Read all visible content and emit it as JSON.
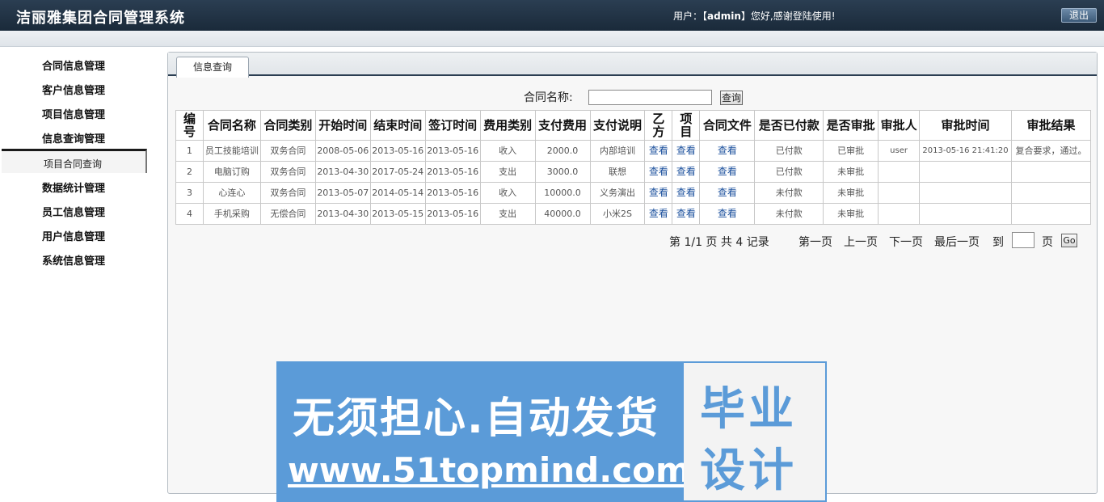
{
  "header": {
    "title": "洁丽雅集团合同管理系统",
    "user_prefix": "用户：【",
    "username": "admin",
    "user_suffix": "】您好,感谢登陆使用!",
    "logout_label": "退出"
  },
  "sidebar": {
    "items": [
      {
        "label": "合同信息管理"
      },
      {
        "label": "客户信息管理"
      },
      {
        "label": "项目信息管理"
      },
      {
        "label": "信息查询管理"
      },
      {
        "label": "数据统计管理"
      },
      {
        "label": "员工信息管理"
      },
      {
        "label": "用户信息管理"
      },
      {
        "label": "系统信息管理"
      }
    ],
    "active_sub": "项目合同查询"
  },
  "main": {
    "tab_label": "信息查询",
    "search": {
      "label": "合同名称:",
      "value": "",
      "button_label": "查询"
    },
    "table": {
      "headers": [
        "编号",
        "合同名称",
        "合同类别",
        "开始时间",
        "结束时间",
        "签订时间",
        "费用类别",
        "支付费用",
        "支付说明",
        "乙方",
        "项目",
        "合同文件",
        "是否已付款",
        "是否审批",
        "审批人",
        "审批时间",
        "审批结果"
      ],
      "rows": [
        [
          "1",
          "员工技能培训",
          "双务合同",
          "2008-05-06",
          "2013-05-16",
          "2013-05-16",
          "收入",
          "2000.0",
          "内部培训",
          "查看",
          "查看",
          "查看",
          "已付款",
          "已审批",
          "user",
          "2013-05-16 21:41:20",
          "复合要求，通过。"
        ],
        [
          "2",
          "电脑订购",
          "双务合同",
          "2013-04-30",
          "2017-05-24",
          "2013-05-16",
          "支出",
          "3000.0",
          "联想",
          "查看",
          "查看",
          "查看",
          "已付款",
          "未审批",
          "",
          "",
          ""
        ],
        [
          "3",
          "心连心",
          "双务合同",
          "2013-05-07",
          "2014-05-14",
          "2013-05-16",
          "收入",
          "10000.0",
          "义务演出",
          "查看",
          "查看",
          "查看",
          "未付款",
          "未审批",
          "",
          "",
          ""
        ],
        [
          "4",
          "手机采购",
          "无偿合同",
          "2013-04-30",
          "2013-05-15",
          "2013-05-16",
          "支出",
          "40000.0",
          "小米2S",
          "查看",
          "查看",
          "查看",
          "未付款",
          "未审批",
          "",
          "",
          ""
        ]
      ]
    },
    "pager": {
      "info": "第 1/1 页 共 4 记录",
      "first": "第一页",
      "prev": "上一页",
      "next": "下一页",
      "last": "最后一页",
      "goto_prefix": "到",
      "goto_suffix": "页",
      "go_label": "Go"
    }
  },
  "banner": {
    "line1": "无须担心.自动发货",
    "line2": "www.51topmind.com",
    "box_line1": "毕业",
    "box_line2": "设计"
  }
}
